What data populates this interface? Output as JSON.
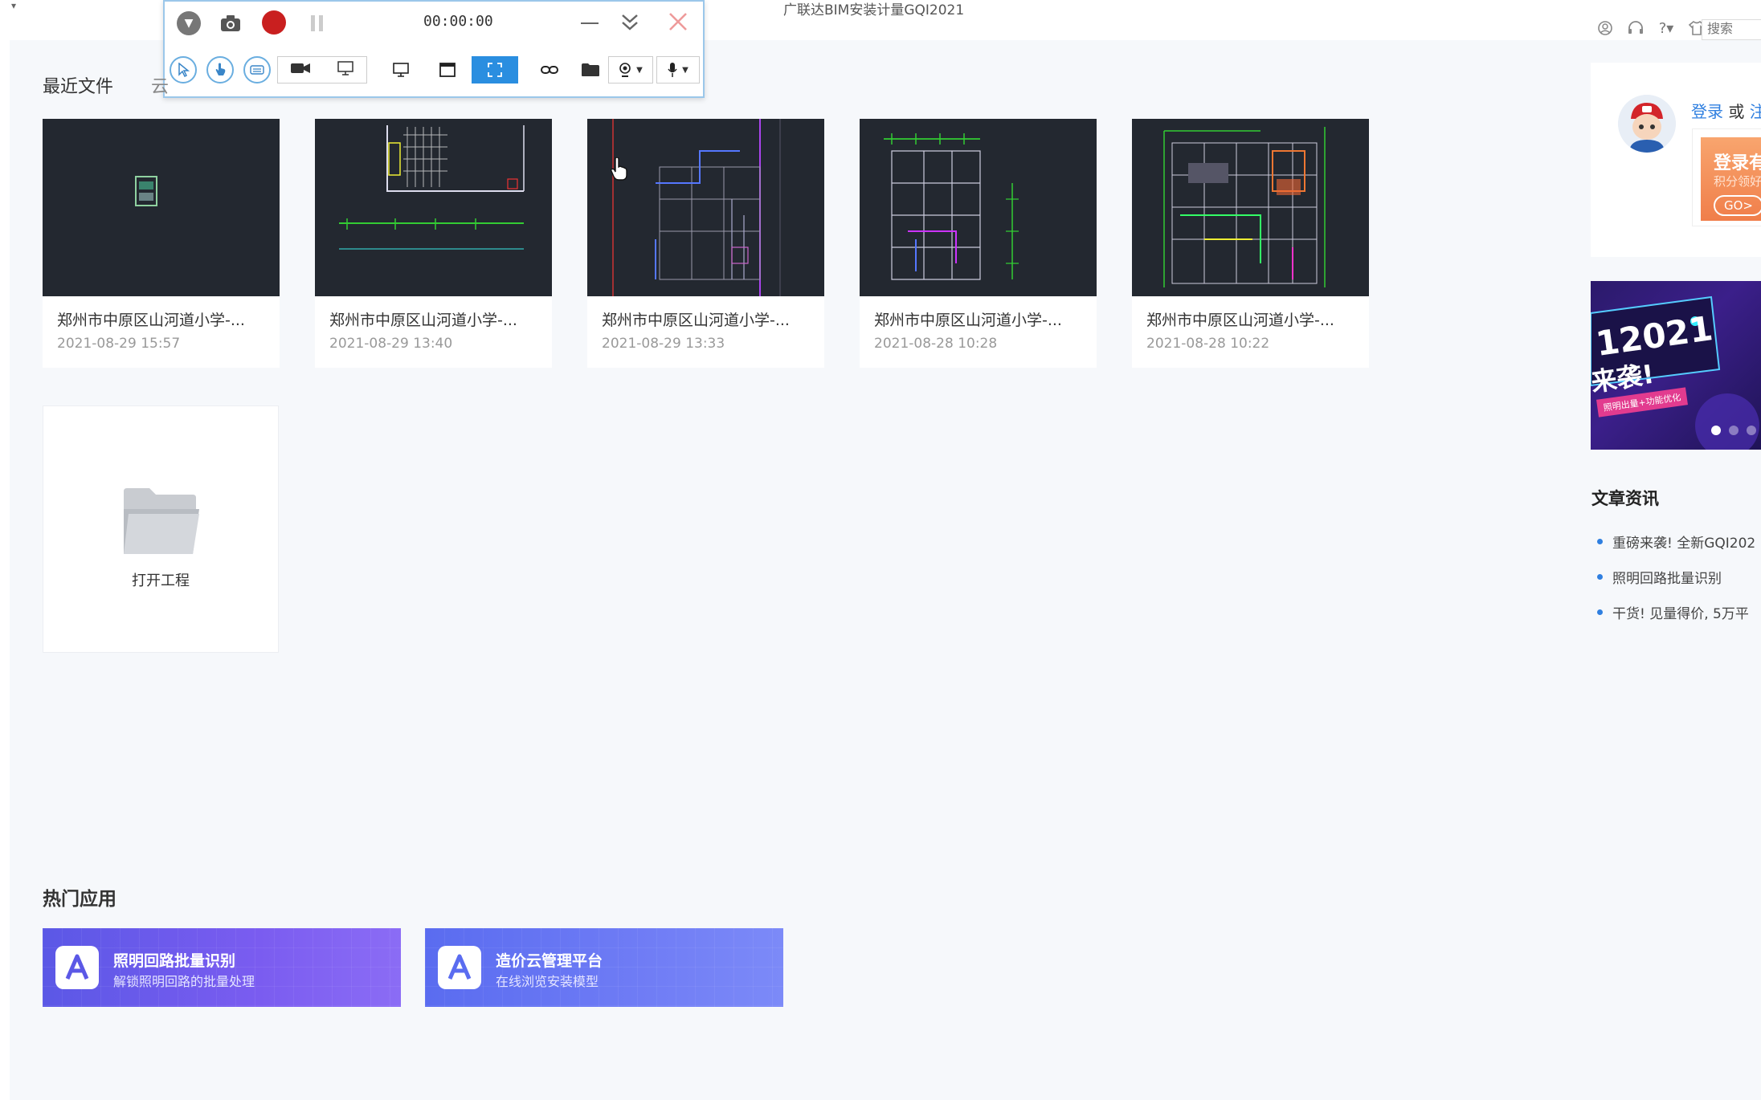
{
  "window": {
    "title": "广联达BIM安装计量GQI2021",
    "search_placeholder": "搜索"
  },
  "recorder": {
    "timer": "00:00:00"
  },
  "recent": {
    "title": "最近文件",
    "tab2": "云",
    "files": [
      {
        "name": "郑州市中原区山河道小学-...",
        "date": "2021-08-29 15:57"
      },
      {
        "name": "郑州市中原区山河道小学-...",
        "date": "2021-08-29 13:40"
      },
      {
        "name": "郑州市中原区山河道小学-...",
        "date": "2021-08-29 13:33"
      },
      {
        "name": "郑州市中原区山河道小学-...",
        "date": "2021-08-28 10:28"
      },
      {
        "name": "郑州市中原区山河道小学-...",
        "date": "2021-08-28 10:22"
      }
    ],
    "open_label": "打开工程"
  },
  "hot_apps": {
    "title": "热门应用",
    "apps": [
      {
        "name": "照明回路批量识别",
        "desc": "解锁照明回路的批量处理"
      },
      {
        "name": "造价云管理平台",
        "desc": "在线浏览安装模型"
      }
    ]
  },
  "login": {
    "login": "登录",
    "or": "或",
    "register": "注",
    "promo_title": "登录有",
    "promo_sub": "积分领好",
    "promo_go": "GO>"
  },
  "banner": {
    "year": "12021",
    "tag": "来袭!",
    "pill": "照明出量+功能优化"
  },
  "news": {
    "title": "文章资讯",
    "items": [
      "重磅来袭! 全新GQI202",
      "照明回路批量识别",
      "干货! 见量得价, 5万平"
    ]
  },
  "colors": {
    "accent": "#2f7fe0",
    "record": "#c91f1f",
    "thumb_bg": "#232830"
  }
}
